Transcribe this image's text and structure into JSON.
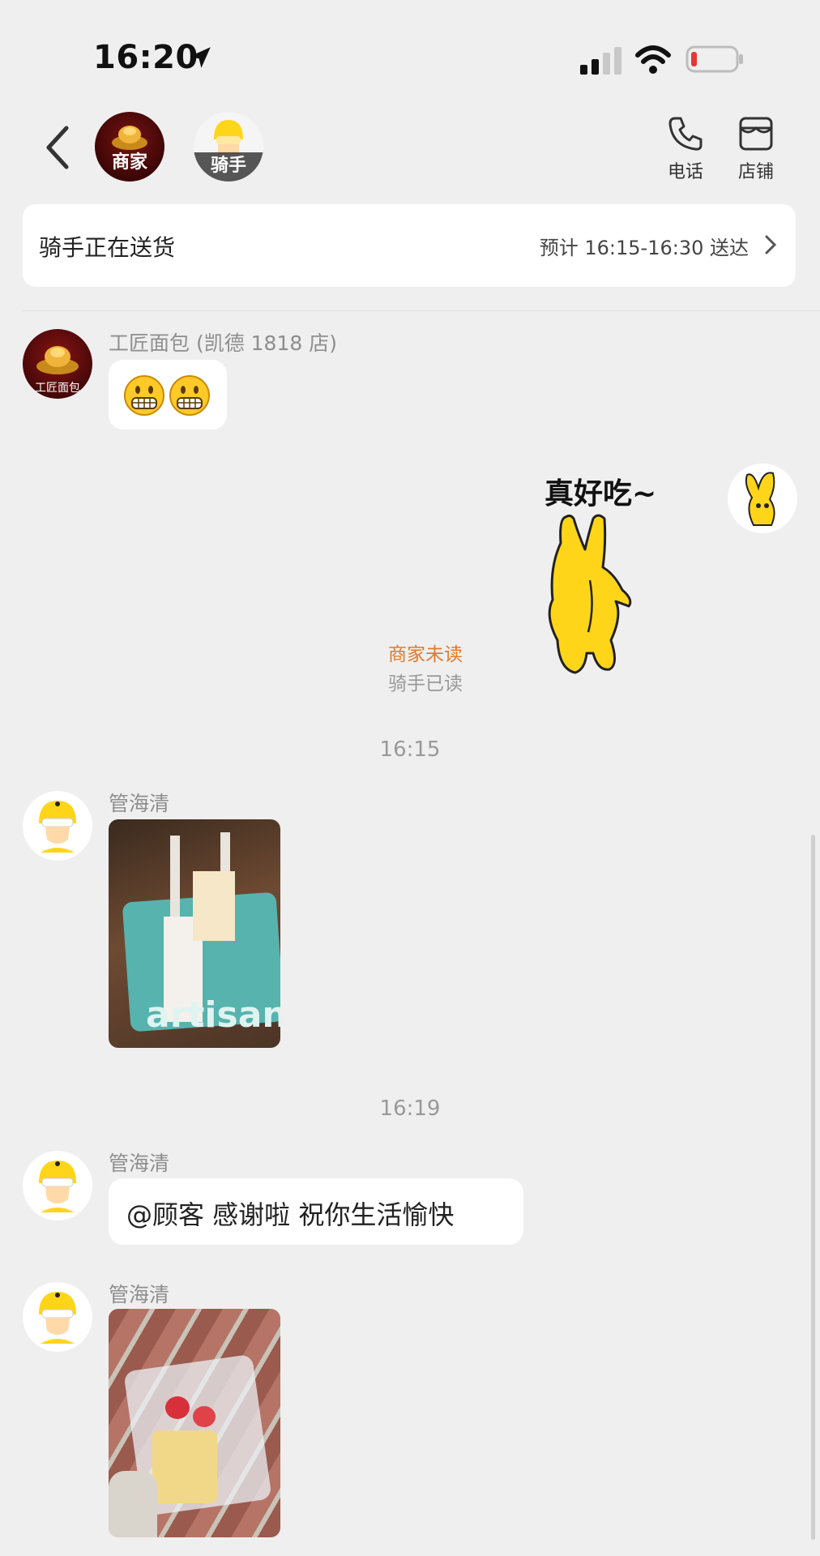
{
  "status_bar": {
    "time": "16:20"
  },
  "header": {
    "shop_avatar_label": "商家",
    "rider_avatar_label": "骑手",
    "phone_label": "电话",
    "store_label": "店铺"
  },
  "delivery_card": {
    "status": "骑手正在送货",
    "eta": "预计 16:15-16:30 送达"
  },
  "messages": {
    "shop_name": "工匠面包 (凯德 1818 店)",
    "shop_avatar_text": "工匠面包",
    "sticker_caption": "真好吃~",
    "read_merchant": "商家未读",
    "read_rider": "骑手已读",
    "time1": "16:15",
    "time2": "16:19",
    "rider_name": "管海清",
    "rider_text": "@顾客 感谢啦 祝你生活愉快",
    "bag_text": "artisan"
  },
  "colors": {
    "unread": "#e07a2c",
    "rider_yellow": "#ffd51a"
  }
}
